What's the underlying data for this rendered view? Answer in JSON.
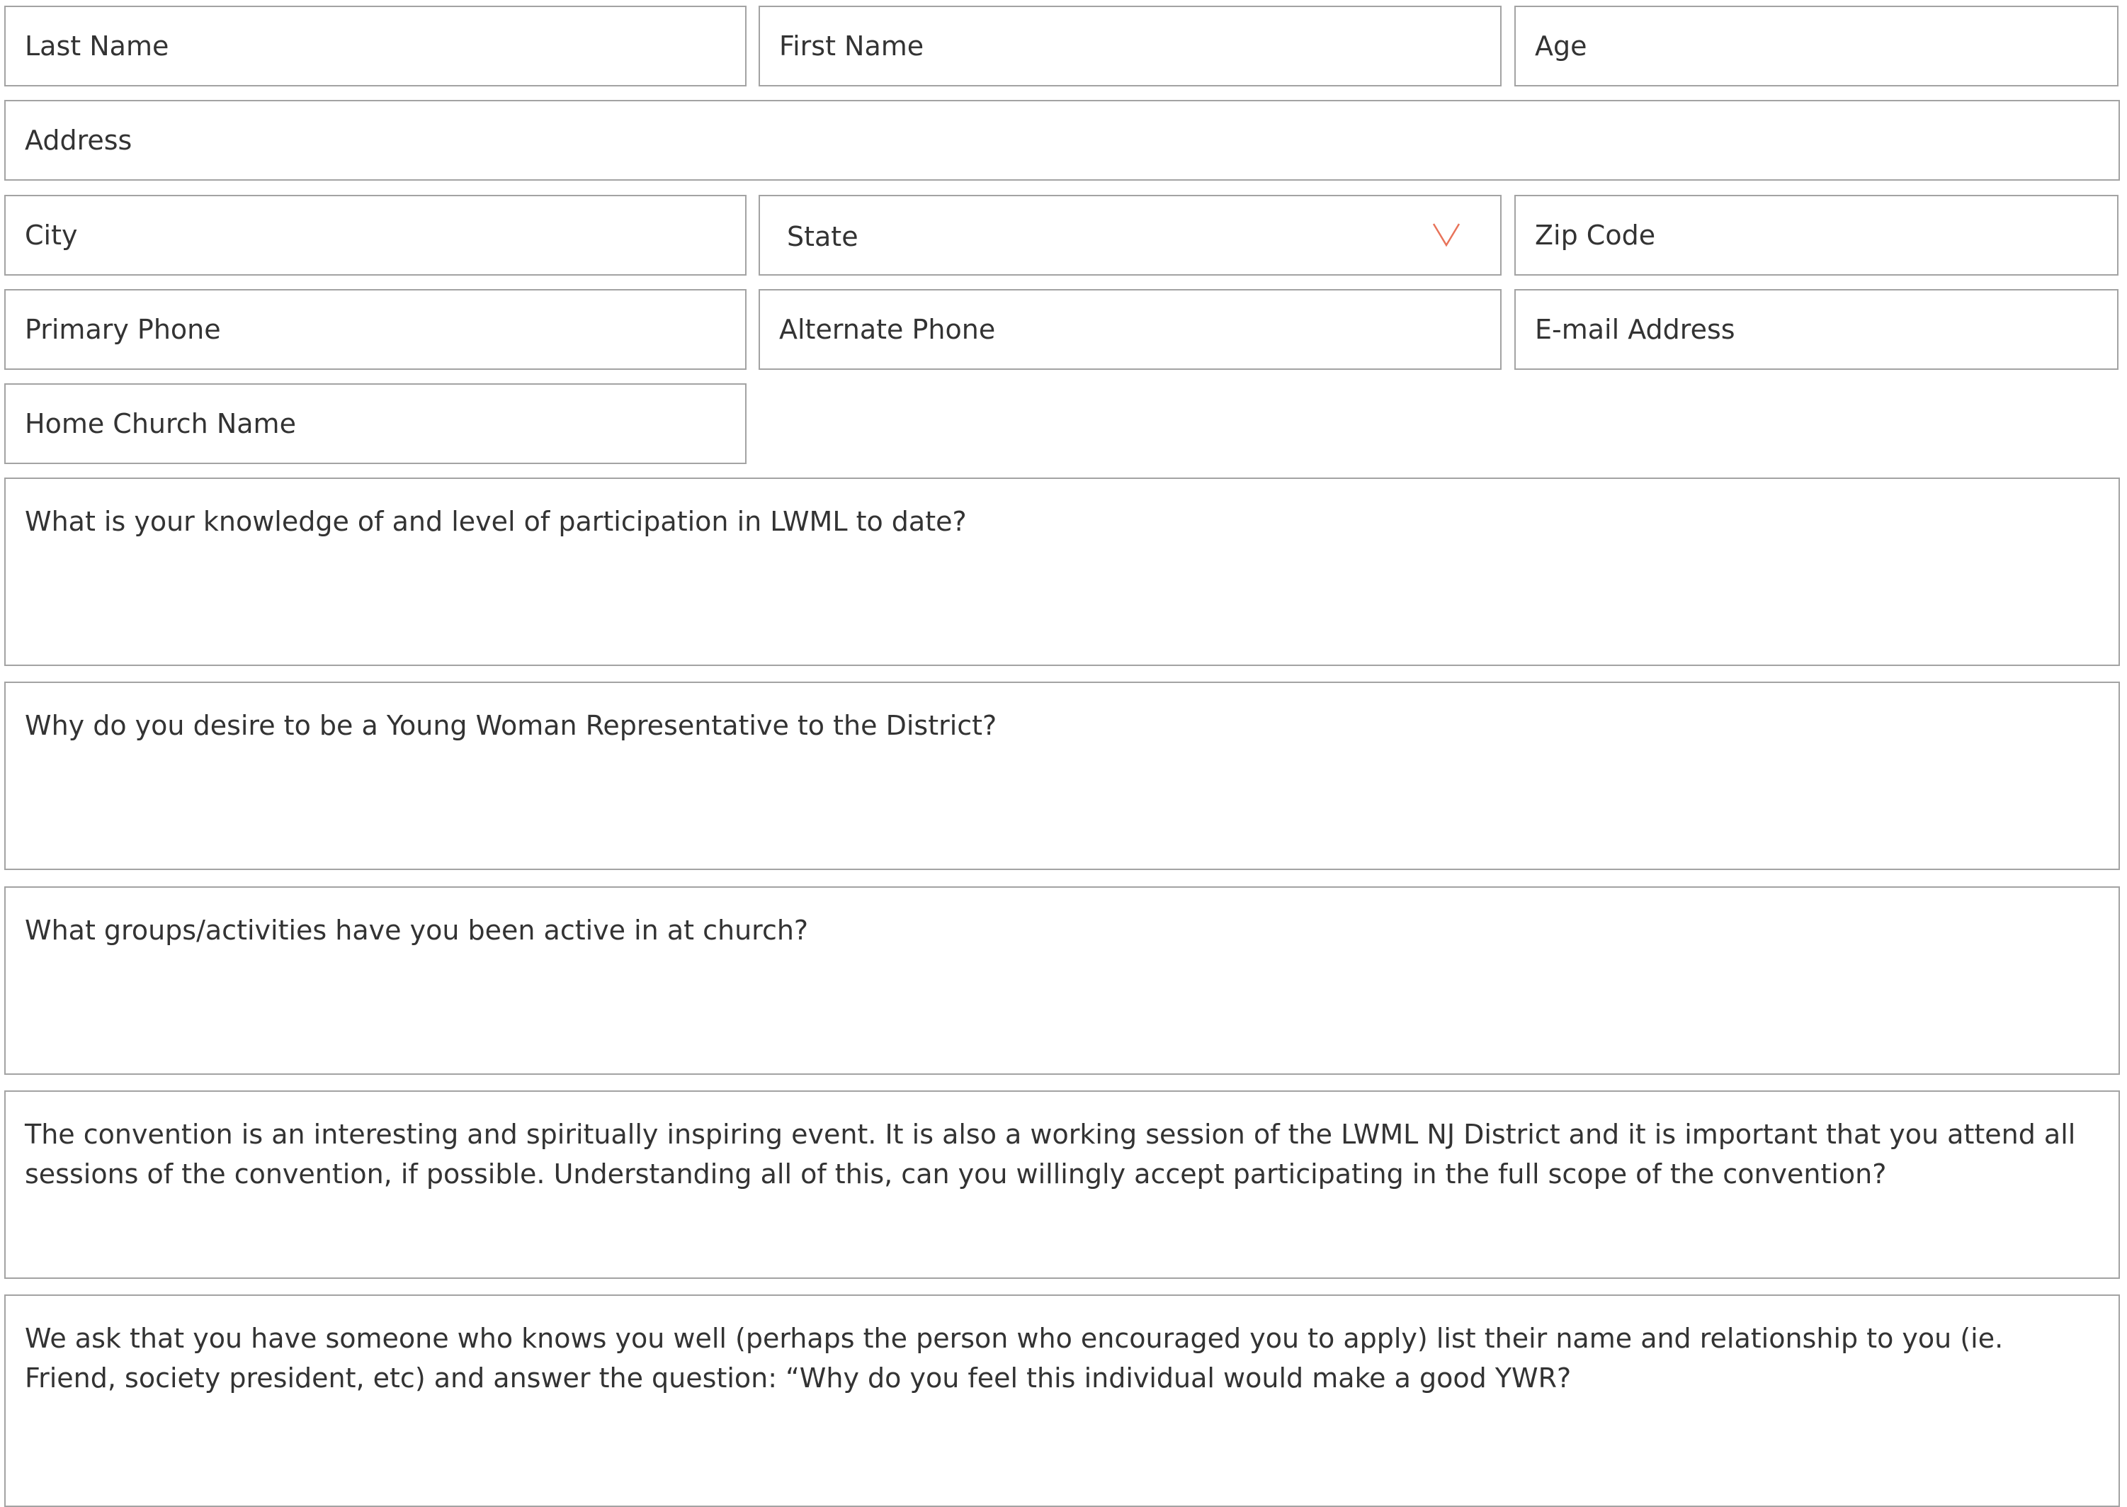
{
  "fields": {
    "last_name": "Last Name",
    "first_name": "First Name",
    "age": "Age",
    "address": "Address",
    "city": "City",
    "state": "State",
    "zip_code": "Zip Code",
    "primary_phone": "Primary Phone",
    "alternate_phone": "Alternate Phone",
    "email": "E-mail Address",
    "home_church": "Home Church Name"
  },
  "questions": {
    "q1": "What is your knowledge of and level of participation in LWML to date?",
    "q2": "Why do you desire to be a Young Woman Representative to the District?",
    "q3": "What groups/activities have you been active in at church?",
    "q4": "The convention is an interesting and spiritually inspiring event. It is also a working session of the LWML NJ District and it is important that you attend all sessions of the convention, if possible. Understanding all of this, can you willingly accept participating in the full scope of the convention?",
    "q5": "We ask that you have someone who knows you well (perhaps the person who encouraged you to apply) list their name and relationship to you (ie. Friend, society president, etc) and answer the question: “Why do you feel this individual would make a good YWR?"
  },
  "icons": {
    "state_dropdown": "chevron-down-icon"
  },
  "colors": {
    "border": "#a3a3a3",
    "text": "#333333",
    "accent": "#e8735a",
    "background": "#ffffff"
  }
}
